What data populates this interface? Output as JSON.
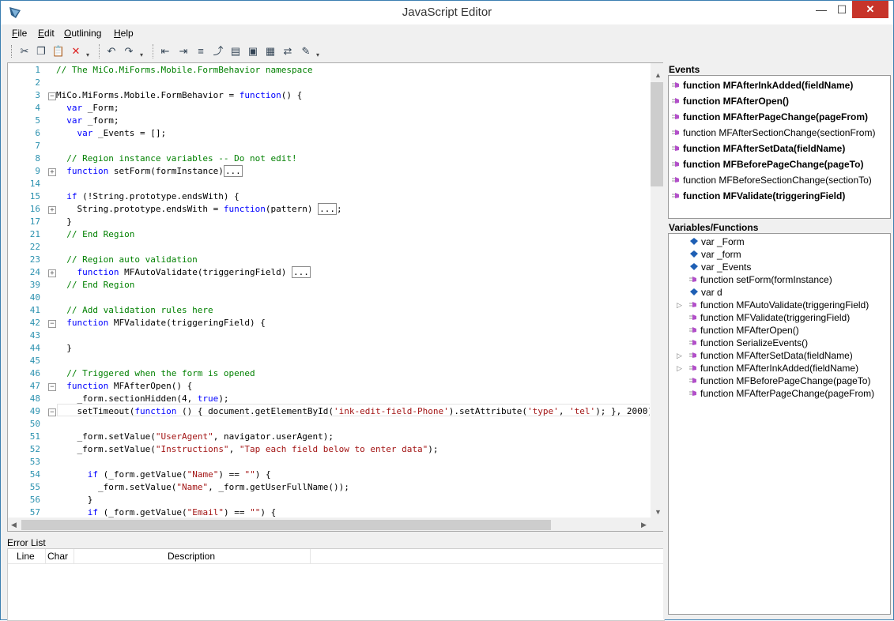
{
  "window": {
    "title": "JavaScript Editor",
    "minimize": "—",
    "maximize": "☐",
    "close": "✕"
  },
  "menu": [
    "File",
    "Edit",
    "Outlining",
    "Help"
  ],
  "menu_accel": [
    "F",
    "E",
    "O",
    "H"
  ],
  "toolbar": {
    "buttons": [
      "cut-icon",
      "copy-icon",
      "paste-icon",
      "delete-icon",
      "undo-icon",
      "redo-icon",
      "outdent-icon",
      "indent-icon",
      "format-icon",
      "comment-icon",
      "uncomment-icon",
      "expand-icon",
      "collapse-icon",
      "toggle-icon",
      "bookmark-icon"
    ],
    "glyphs": [
      "✂",
      "❐",
      "📋",
      "✕",
      "↶",
      "↷",
      "⇤",
      "⇥",
      "≡",
      "⤴",
      "▤",
      "▣",
      "▦",
      "⇄",
      "✎"
    ]
  },
  "editor": {
    "lines": [
      {
        "n": "1",
        "fold": "",
        "text": "// The MiCo.MiForms.Mobile.FormBehavior namespace",
        "kind": "comment"
      },
      {
        "n": "2",
        "fold": "",
        "text": "",
        "kind": "code"
      },
      {
        "n": "3",
        "fold": "−",
        "text": "MiCo.MiForms.Mobile.FormBehavior = function() {",
        "kind": "code"
      },
      {
        "n": "4",
        "fold": "",
        "text": "  var _Form;",
        "kind": "code"
      },
      {
        "n": "5",
        "fold": "",
        "text": "  var _form;",
        "kind": "code"
      },
      {
        "n": "6",
        "fold": "",
        "text": "    var _Events = [];",
        "kind": "code"
      },
      {
        "n": "7",
        "fold": "",
        "text": "",
        "kind": "code"
      },
      {
        "n": "8",
        "fold": "",
        "text": "  // Region instance variables -- Do not edit!",
        "kind": "comment"
      },
      {
        "n": "9",
        "fold": "+",
        "text": "  function setForm(formInstance)...",
        "kind": "code"
      },
      {
        "n": "14",
        "fold": "",
        "text": "",
        "kind": "code"
      },
      {
        "n": "15",
        "fold": "",
        "text": "  if (!String.prototype.endsWith) {",
        "kind": "code"
      },
      {
        "n": "16",
        "fold": "+",
        "text": "    String.prototype.endsWith = function(pattern) ...;",
        "kind": "code"
      },
      {
        "n": "17",
        "fold": "",
        "text": "  }",
        "kind": "code"
      },
      {
        "n": "21",
        "fold": "",
        "text": "  // End Region",
        "kind": "comment"
      },
      {
        "n": "22",
        "fold": "",
        "text": "",
        "kind": "code"
      },
      {
        "n": "23",
        "fold": "",
        "text": "  // Region auto validation",
        "kind": "comment"
      },
      {
        "n": "24",
        "fold": "+",
        "text": "    function MFAutoValidate(triggeringField) ...",
        "kind": "code"
      },
      {
        "n": "39",
        "fold": "",
        "text": "  // End Region",
        "kind": "comment"
      },
      {
        "n": "40",
        "fold": "",
        "text": "",
        "kind": "code"
      },
      {
        "n": "41",
        "fold": "",
        "text": "  // Add validation rules here",
        "kind": "comment"
      },
      {
        "n": "42",
        "fold": "−",
        "text": "  function MFValidate(triggeringField) {",
        "kind": "code"
      },
      {
        "n": "43",
        "fold": "",
        "text": "",
        "kind": "code"
      },
      {
        "n": "44",
        "fold": "",
        "text": "  }",
        "kind": "code"
      },
      {
        "n": "45",
        "fold": "",
        "text": "",
        "kind": "code"
      },
      {
        "n": "46",
        "fold": "",
        "text": "  // Triggered when the form is opened",
        "kind": "comment"
      },
      {
        "n": "47",
        "fold": "−",
        "text": "  function MFAfterOpen() {",
        "kind": "code"
      },
      {
        "n": "48",
        "fold": "",
        "text": "    _form.sectionHidden(4, true);",
        "kind": "code"
      },
      {
        "n": "49",
        "fold": "−",
        "text": "    setTimeout(function () { document.getElementById('ink-edit-field-Phone').setAttribute('type', 'tel'); }, 2000)",
        "kind": "code"
      },
      {
        "n": "50",
        "fold": "",
        "text": "",
        "kind": "code"
      },
      {
        "n": "51",
        "fold": "",
        "text": "    _form.setValue(\"UserAgent\", navigator.userAgent);",
        "kind": "code"
      },
      {
        "n": "52",
        "fold": "",
        "text": "    _form.setValue(\"Instructions\", \"Tap each field below to enter data\");",
        "kind": "code"
      },
      {
        "n": "53",
        "fold": "",
        "text": "",
        "kind": "code"
      },
      {
        "n": "54",
        "fold": "",
        "text": "      if (_form.getValue(\"Name\") == \"\") {",
        "kind": "code"
      },
      {
        "n": "55",
        "fold": "",
        "text": "        _form.setValue(\"Name\", _form.getUserFullName());",
        "kind": "code"
      },
      {
        "n": "56",
        "fold": "",
        "text": "      }",
        "kind": "code"
      },
      {
        "n": "57",
        "fold": "",
        "text": "      if (_form.getValue(\"Email\") == \"\") {",
        "kind": "code"
      }
    ]
  },
  "error_list": {
    "title": "Error List",
    "columns": [
      "Line",
      "Char",
      "Description"
    ]
  },
  "events_panel": {
    "title": "Events",
    "items": [
      {
        "label": "function MFAfterInkAdded(fieldName)",
        "bold": true
      },
      {
        "label": "function MFAfterOpen()",
        "bold": true
      },
      {
        "label": "function MFAfterPageChange(pageFrom)",
        "bold": true
      },
      {
        "label": "function MFAfterSectionChange(sectionFrom)",
        "bold": false
      },
      {
        "label": "function MFAfterSetData(fieldName)",
        "bold": true
      },
      {
        "label": "function MFBeforePageChange(pageTo)",
        "bold": true
      },
      {
        "label": "function MFBeforeSectionChange(sectionTo)",
        "bold": false
      },
      {
        "label": "function MFValidate(triggeringField)",
        "bold": true
      }
    ]
  },
  "vars_panel": {
    "title": "Variables/Functions",
    "items": [
      {
        "label": "var _Form",
        "kind": "var",
        "expandable": false
      },
      {
        "label": "var _form",
        "kind": "var",
        "expandable": false
      },
      {
        "label": "var _Events",
        "kind": "var",
        "expandable": false
      },
      {
        "label": "function setForm(formInstance)",
        "kind": "func",
        "expandable": false
      },
      {
        "label": "var d",
        "kind": "var",
        "expandable": false
      },
      {
        "label": "function MFAutoValidate(triggeringField)",
        "kind": "func",
        "expandable": true
      },
      {
        "label": "function MFValidate(triggeringField)",
        "kind": "func",
        "expandable": false
      },
      {
        "label": "function MFAfterOpen()",
        "kind": "func",
        "expandable": false
      },
      {
        "label": "function SerializeEvents()",
        "kind": "func",
        "expandable": false
      },
      {
        "label": "function MFAfterSetData(fieldName)",
        "kind": "func",
        "expandable": true
      },
      {
        "label": "function MFAfterInkAdded(fieldName)",
        "kind": "func",
        "expandable": true
      },
      {
        "label": "function MFBeforePageChange(pageTo)",
        "kind": "func",
        "expandable": false
      },
      {
        "label": "function MFAfterPageChange(pageFrom)",
        "kind": "func",
        "expandable": false
      }
    ]
  },
  "colors": {
    "comment": "#008000",
    "keyword": "#0000ff",
    "line_number": "#2b91af",
    "string": "#a31515",
    "method_icon": "#b24fc9",
    "var_icon": "#1e5fb4"
  }
}
